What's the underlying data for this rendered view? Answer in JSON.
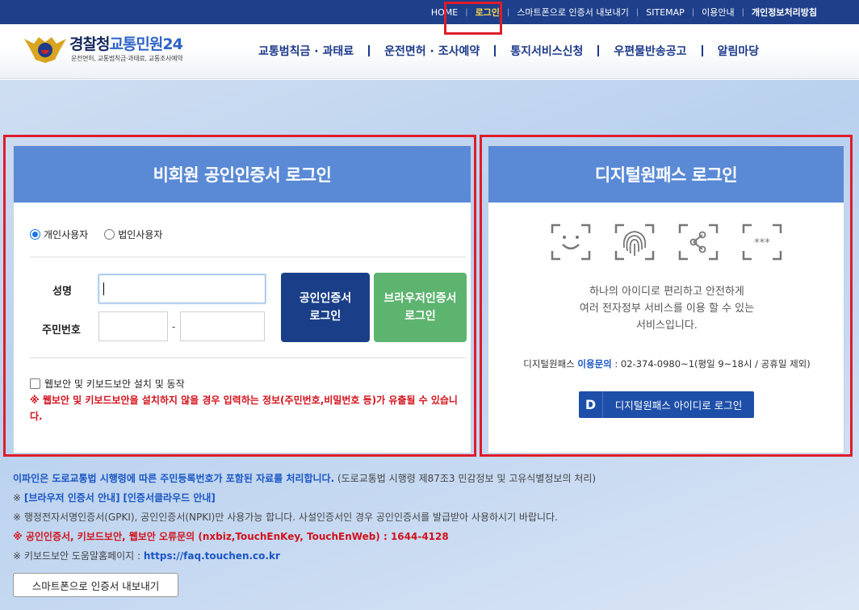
{
  "topbar": {
    "links": [
      "HOME",
      "로그인",
      "스마트폰으로 인증서 내보내기",
      "SITEMAP",
      "이용안내",
      "개인정보처리방침"
    ]
  },
  "logo": {
    "title_main": "경찰청",
    "title_accent": "교통민원24",
    "subtitle": "운전면허, 교통범칙금·과태료, 교통조사예약"
  },
  "gnb": [
    "교통범칙금 · 과태료",
    "운전면허 · 조사예약",
    "통지서비스신청",
    "우편물반송공고",
    "알림마당"
  ],
  "left_panel": {
    "title": "비회원 공인인증서 로그인",
    "radio_personal": "개인사용자",
    "radio_corporate": "법인사용자",
    "name_label": "성명",
    "rrn_label": "주민번호",
    "rrn_separator": "-",
    "cert_button_line1": "공인인증서",
    "cert_button_line2": "로그인",
    "browser_button_line1": "브라우저인증서",
    "browser_button_line2": "로그인",
    "security_checkbox": "웹보안 및 키보드보안 설치 및 동작",
    "warning": "※ 웹보안 및 키보드보안을 설치하지 않을 경우 입력하는 정보(주민번호,비밀번호 등)가 유출될 수 있습니다."
  },
  "right_panel": {
    "title": "디지털원패스 로그인",
    "icons": [
      "face-recognition-icon",
      "fingerprint-icon",
      "pattern-icon",
      "pin-code-icon"
    ],
    "pin_text": "***",
    "desc_line1": "하나의 아이디로 편리하고 안전하게",
    "desc_line2": "여러 전자정부 서비스를 이용 할 수 있는",
    "desc_line3": "서비스입니다.",
    "contact_prefix": "디지털원패스 ",
    "contact_label": "이용문의",
    "contact_value": " : 02-374-0980~1(평일 9~18시 / 공휴일 제외)",
    "login_badge": "D",
    "login_button": "디지털원패스 아이디로 로그인"
  },
  "notices": {
    "line1_bold": "이파인은 도로교통법 시행령에 따른 주민등록번호가 포함된 자료를 처리합니다.",
    "line1_rest": " (도로교통법 시행령 제87조3 민감정보 및 고유식별정보의 처리)",
    "line2_prefix": "※ ",
    "line2_link1": "[브라우저 인증서 안내]",
    "line2_link2": "[인증서클라우드 안내]",
    "line3": "※ 행정전자서명인증서(GPKI), 공인인증서(NPKI)만 사용가능 합니다. 사설인증서인 경우 공인인증서를 발급받아 사용하시기 바랍니다.",
    "line4": "※ 공인인증서, 키보드보안, 웹보안 오류문의 (nxbiz,TouchEnKey, TouchEnWeb) : 1644-4128",
    "line5_prefix": "※ 키보드보안 도움말홈페이지 : ",
    "line5_link": "https://faq.touchen.co.kr"
  },
  "export_button": "스마트폰으로 인증서 내보내기",
  "colors": {
    "topbar": "#1e3f8a",
    "panel_header": "#5a8ad6",
    "cert_button": "#1a3f88",
    "browser_button": "#5cb46f",
    "highlight": "#e01c2a"
  }
}
